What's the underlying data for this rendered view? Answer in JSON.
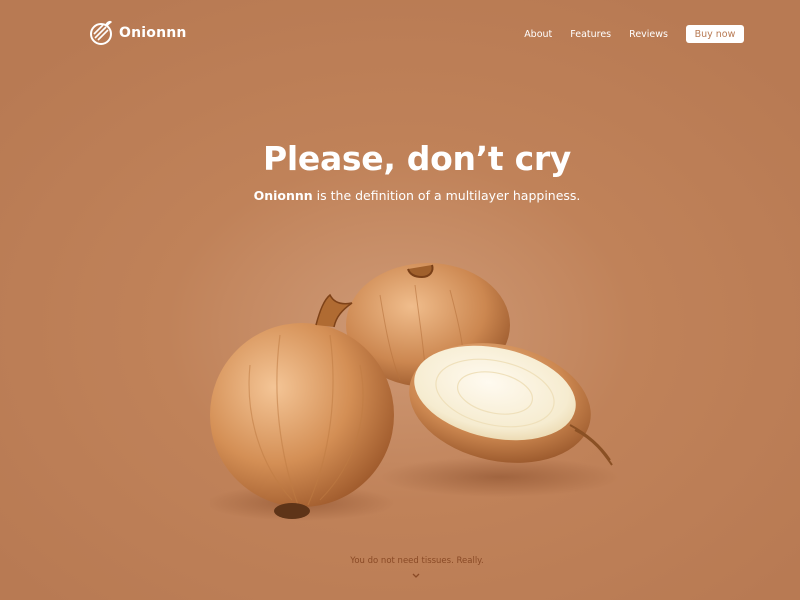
{
  "brand": {
    "name": "Onionnn"
  },
  "nav": {
    "items": [
      {
        "label": "About"
      },
      {
        "label": "Features"
      },
      {
        "label": "Reviews"
      }
    ],
    "cta_label": "Buy now"
  },
  "hero": {
    "title": "Please, don’t cry",
    "subtitle_brand": "Onionnn",
    "subtitle_rest": " is the definition of a multilayer happiness."
  },
  "footer": {
    "note": "You do not need tissues. Really."
  },
  "colors": {
    "background": "#b87a53",
    "accent_text": "#8a4a26",
    "button_bg": "#ffffff"
  },
  "icons": {
    "logo": "onion-logo-icon",
    "scroll": "chevron-down-icon"
  }
}
